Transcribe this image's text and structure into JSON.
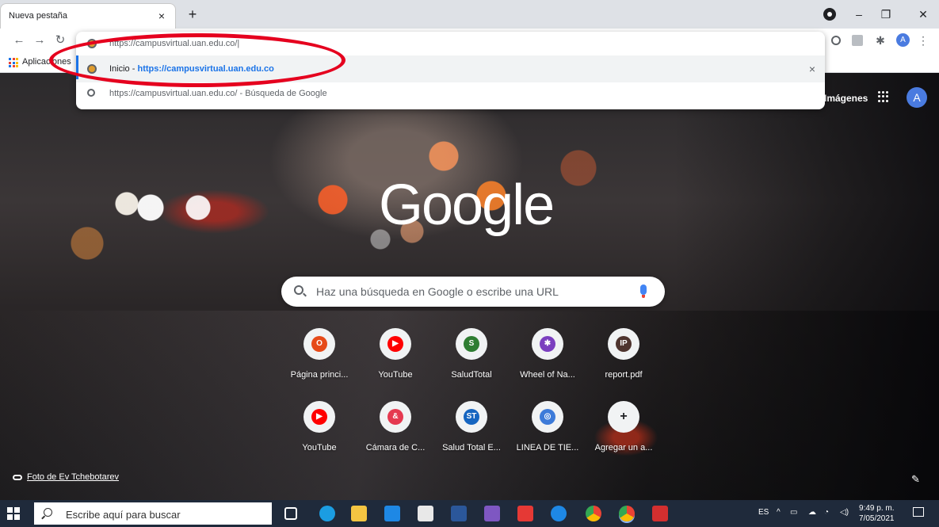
{
  "browser": {
    "tab_title": "Nueva pestaña",
    "tab_close": "×",
    "new_tab": "+",
    "bookmarks_label": "Aplicaciones",
    "avatar_letter": "A"
  },
  "omnibox": {
    "typed_url": "https://campusvirtual.uan.edu.co/|",
    "suggestion_title": "Inicio - ",
    "suggestion_url": "https://campusvirtual.uan.edu.co",
    "search_suggestion": "https://campusvirtual.uan.edu.co/",
    "search_suffix": " - Búsqueda de Google",
    "remove": "×"
  },
  "ntp": {
    "images_link": "Imágenes",
    "avatar_letter": "A",
    "logo": "Google",
    "search_placeholder": "Haz una búsqueda en Google o escribe una URL",
    "shortcuts": [
      {
        "label": "Página princi...",
        "glyph": "O",
        "color": "#e64a19"
      },
      {
        "label": "YouTube",
        "glyph": "▶",
        "color": "#ff0000"
      },
      {
        "label": "SaludTotal",
        "glyph": "S",
        "color": "#2e7d32"
      },
      {
        "label": "Wheel of Na...",
        "glyph": "✱",
        "color": "#7b3fbf"
      },
      {
        "label": "report.pdf",
        "glyph": "IP",
        "color": "#4e342e"
      },
      {
        "label": "YouTube",
        "glyph": "▶",
        "color": "#ff0000"
      },
      {
        "label": "Cámara de C...",
        "glyph": "&",
        "color": "#e53950"
      },
      {
        "label": "Salud Total E...",
        "glyph": "ST",
        "color": "#1565c0"
      },
      {
        "label": "LINEA DE TIE...",
        "glyph": "◎",
        "color": "#3d7bd9"
      },
      {
        "label": "Agregar un a...",
        "glyph": "+",
        "color": "#f1f3f4"
      }
    ],
    "photo_credit": "Foto de Ev Tchebotarev"
  },
  "taskbar": {
    "search_placeholder": "Escribe aquí para buscar",
    "lang": "ES",
    "time": "9:49 p. m.",
    "date": "7/05/2021"
  }
}
